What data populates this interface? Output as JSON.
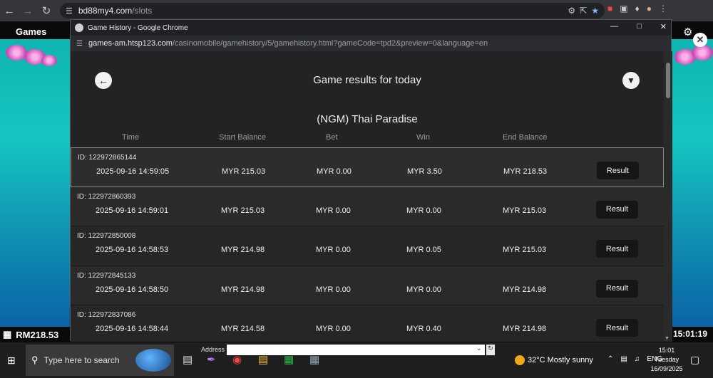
{
  "browser": {
    "url_host": "bd88my4.com",
    "url_path": "/slots"
  },
  "game": {
    "title": "Games",
    "balance": "RM218.53",
    "time": "15:01:19"
  },
  "popup": {
    "window_title": "Game History - Google Chrome",
    "url_host": "games-am.htsp123.com",
    "url_path": "/casinomobile/gamehistory/5/gamehistory.html?gameCode=tpd2&preview=0&language=en",
    "heading": "Game results for today",
    "game_name": "(NGM) Thai Paradise",
    "columns": [
      "Time",
      "Start Balance",
      "Bet",
      "Win",
      "End Balance"
    ],
    "result_label": "Result",
    "rows": [
      {
        "id": "ID:  122972865144",
        "time": "2025-09-16 14:59:05",
        "start": "MYR 215.03",
        "bet": "MYR 0.00",
        "win": "MYR 3.50",
        "end": "MYR 218.53"
      },
      {
        "id": "ID:  122972860393",
        "time": "2025-09-16 14:59:01",
        "start": "MYR 215.03",
        "bet": "MYR 0.00",
        "win": "MYR 0.00",
        "end": "MYR 215.03"
      },
      {
        "id": "ID:  122972850008",
        "time": "2025-09-16 14:58:53",
        "start": "MYR 214.98",
        "bet": "MYR 0.00",
        "win": "MYR 0.05",
        "end": "MYR 215.03"
      },
      {
        "id": "ID:  122972845133",
        "time": "2025-09-16 14:58:50",
        "start": "MYR 214.98",
        "bet": "MYR 0.00",
        "win": "MYR 0.00",
        "end": "MYR 214.98"
      },
      {
        "id": "ID:  122972837086",
        "time": "2025-09-16 14:58:44",
        "start": "MYR 214.58",
        "bet": "MYR 0.00",
        "win": "MYR 0.40",
        "end": "MYR 214.98"
      }
    ]
  },
  "taskbar": {
    "search_placeholder": "Type here to search",
    "address_label": "Address",
    "weather": "32°C  Mostly sunny",
    "lang": "ENG",
    "clock_time": "15:01",
    "clock_day": "Tuesday",
    "clock_date": "16/09/2025"
  }
}
